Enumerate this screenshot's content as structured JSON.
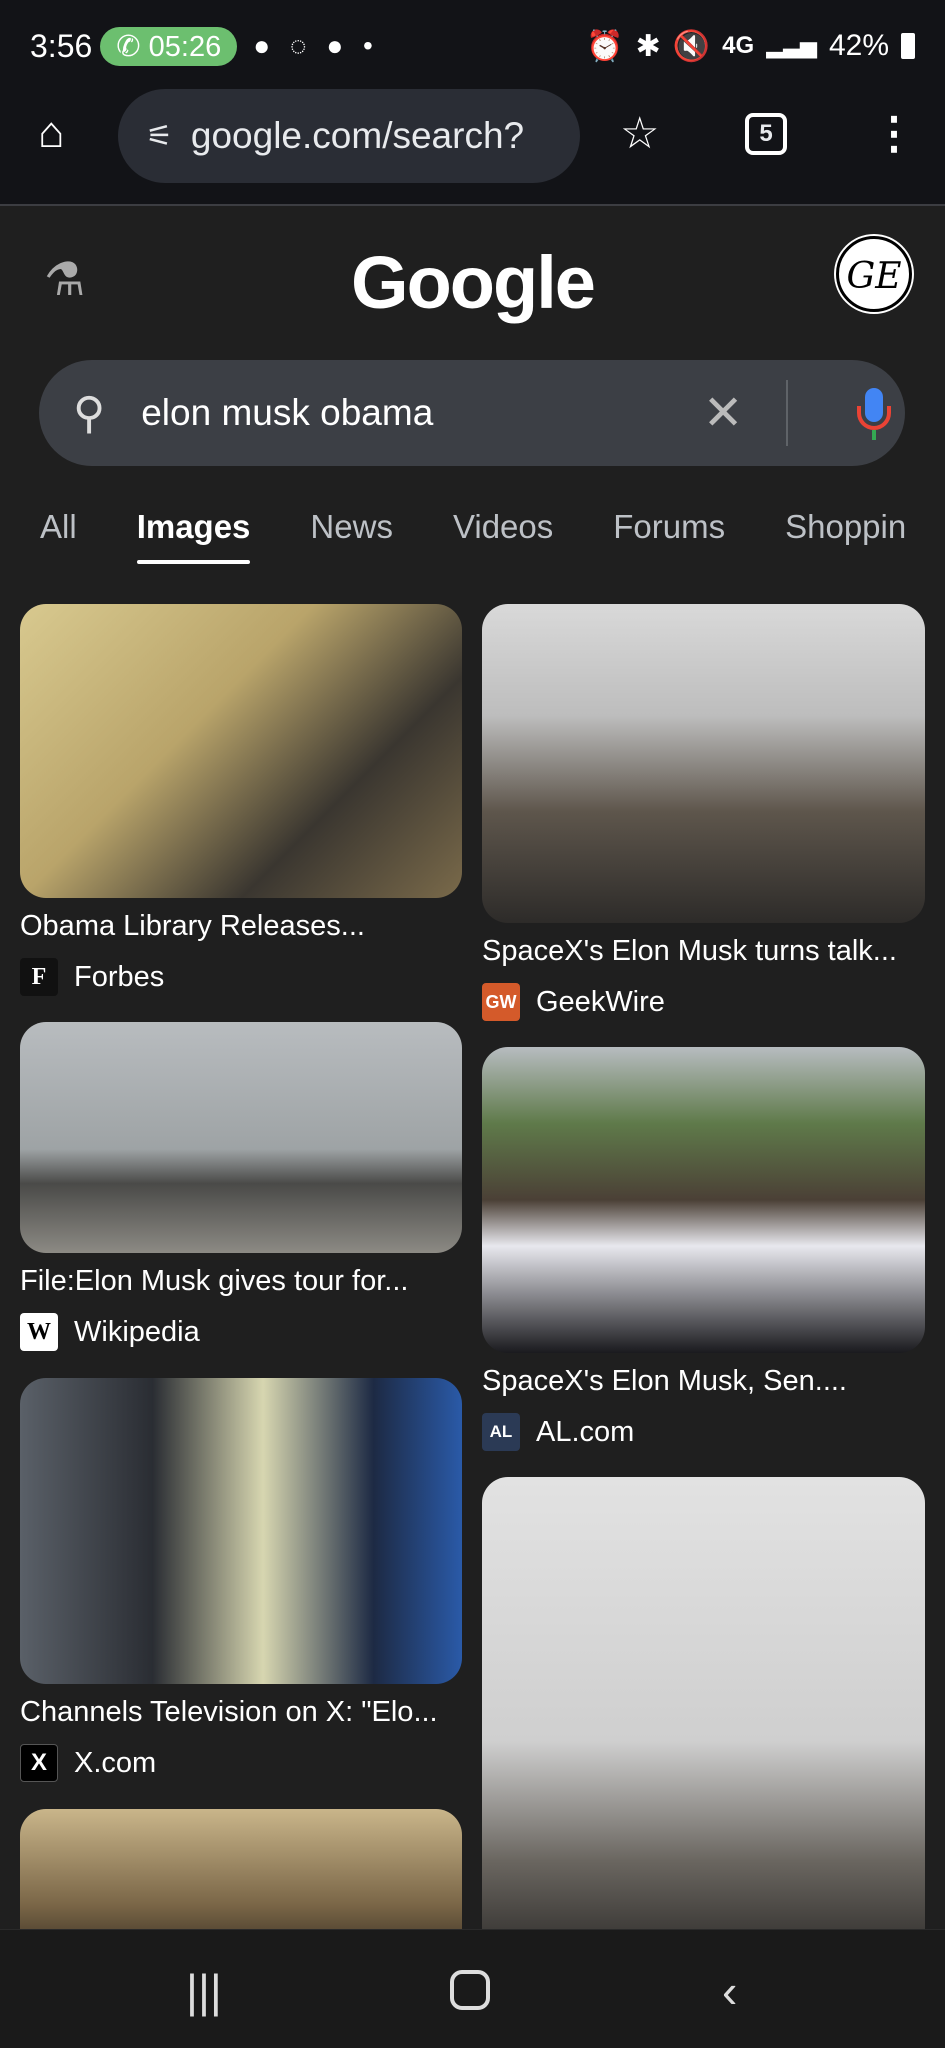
{
  "status": {
    "time": "3:56",
    "call_timer": "05:26",
    "network": "4G",
    "battery": "42%"
  },
  "browser": {
    "url": "google.com/search?",
    "tab_count": "5"
  },
  "google": {
    "logo": "Google",
    "avatar_text": "GE",
    "query": "elon musk obama"
  },
  "tabs": [
    {
      "label": "All"
    },
    {
      "label": "Images",
      "active": true
    },
    {
      "label": "News"
    },
    {
      "label": "Videos"
    },
    {
      "label": "Forums"
    },
    {
      "label": "Shoppin"
    }
  ],
  "results": [
    {
      "title": "Obama Library Releases...",
      "source": "Forbes",
      "favicon": "F",
      "favicon_color": "#111111"
    },
    {
      "title": "SpaceX's Elon Musk turns talk...",
      "source": "GeekWire",
      "favicon": "GW",
      "favicon_color": "#d45a2a"
    },
    {
      "title": "File:Elon Musk gives tour for...",
      "source": "Wikipedia",
      "favicon": "W",
      "favicon_color": "#ffffff"
    },
    {
      "title": "SpaceX's Elon Musk, Sen....",
      "source": "AL.com",
      "favicon": "AL",
      "favicon_color": "#2b3a55"
    },
    {
      "title": "Channels Television on X: \"Elo...",
      "source": "X.com",
      "favicon": "X",
      "favicon_color": "#000000"
    }
  ]
}
